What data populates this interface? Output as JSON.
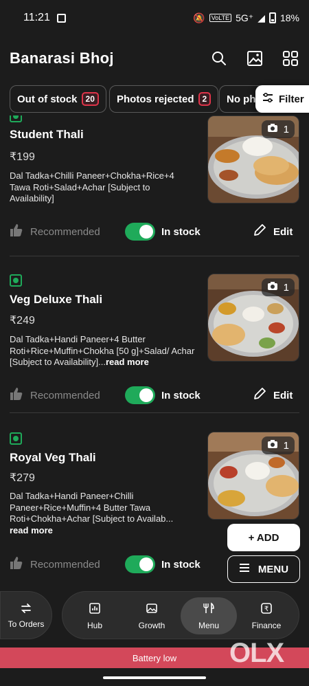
{
  "status_bar": {
    "time": "11:21",
    "network": "5G⁺",
    "battery": "18%",
    "volte": "VoLTE"
  },
  "header": {
    "title": "Banarasi Bhoj"
  },
  "chips": [
    {
      "label": "Out of stock",
      "count": "20"
    },
    {
      "label": "Photos rejected",
      "count": "2"
    },
    {
      "label": "No ph"
    }
  ],
  "filter": {
    "label": "Filter"
  },
  "items": [
    {
      "name": "Student Thali",
      "price": "₹199",
      "description": "Dal Tadka+Chilli Paneer+Chokha+Rice+4 Tawa Roti+Salad+Achar [Subject to Availability]",
      "read_more": "",
      "photo_count": "1",
      "recommended_label": "Recommended",
      "stock_label": "In stock",
      "in_stock": true,
      "edit_label": "Edit"
    },
    {
      "name": "Veg Deluxe Thali",
      "price": "₹249",
      "description": "Dal Tadka+Handi Paneer+4 Butter Roti+Rice+Muffin+Chokha [50 g]+Salad/ Achar [Subject to Availability]...",
      "read_more": "read more",
      "photo_count": "1",
      "recommended_label": "Recommended",
      "stock_label": "In stock",
      "in_stock": true,
      "edit_label": "Edit"
    },
    {
      "name": "Royal Veg Thali",
      "price": "₹279",
      "description": "Dal Tadka+Handi Paneer+Chilli Paneer+Rice+Muffin+4 Butter Tawa Roti+Chokha+Achar [Subject to Availab...",
      "read_more": "read more",
      "photo_count": "1",
      "recommended_label": "Recommended",
      "stock_label": "In stock",
      "in_stock": true,
      "edit_label": "Edit"
    }
  ],
  "fab": {
    "add_label": "+ ADD",
    "menu_label": "MENU"
  },
  "bottom_nav": {
    "to_orders": "To Orders",
    "items": [
      {
        "label": "Hub",
        "icon": "chart-icon"
      },
      {
        "label": "Growth",
        "icon": "image-icon"
      },
      {
        "label": "Menu",
        "icon": "fork-knife-icon",
        "active": true
      },
      {
        "label": "Finance",
        "icon": "rupee-icon"
      }
    ]
  },
  "banner": {
    "text": "Battery low"
  },
  "watermark": {
    "text": "OLX"
  },
  "colors": {
    "background": "#1c1c1c",
    "accent_green": "#1faa5a",
    "badge_red": "#e0344a",
    "banner": "#d3485a"
  }
}
